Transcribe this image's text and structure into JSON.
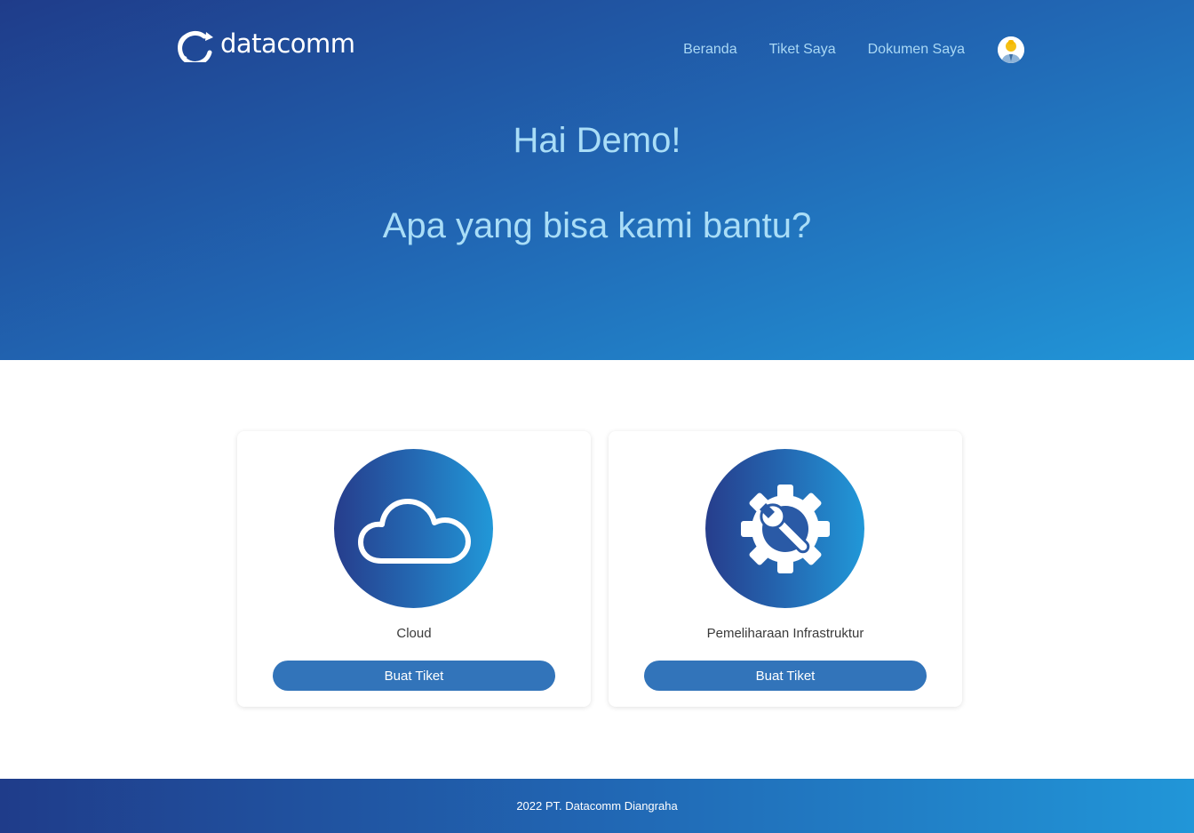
{
  "header": {
    "logo_text": "datacomm",
    "nav": [
      {
        "label": "Beranda"
      },
      {
        "label": "Tiket Saya"
      },
      {
        "label": "Dokumen Saya"
      }
    ],
    "avatar_icon": "user-avatar-icon"
  },
  "hero": {
    "greeting": "Hai Demo!",
    "question": "Apa yang bisa kami bantu?"
  },
  "cards": [
    {
      "title": "Cloud",
      "icon": "cloud-icon",
      "button_label": "Buat Tiket"
    },
    {
      "title": "Pemeliharaan Infrastruktur",
      "icon": "gear-wrench-icon",
      "button_label": "Buat Tiket"
    }
  ],
  "footer": {
    "text": "2022 PT. Datacomm Diangraha"
  },
  "colors": {
    "hero_gradient_start": "#1f3c8a",
    "hero_gradient_end": "#2196d8",
    "nav_text": "#a9d8f5",
    "button": "#3274ba"
  }
}
